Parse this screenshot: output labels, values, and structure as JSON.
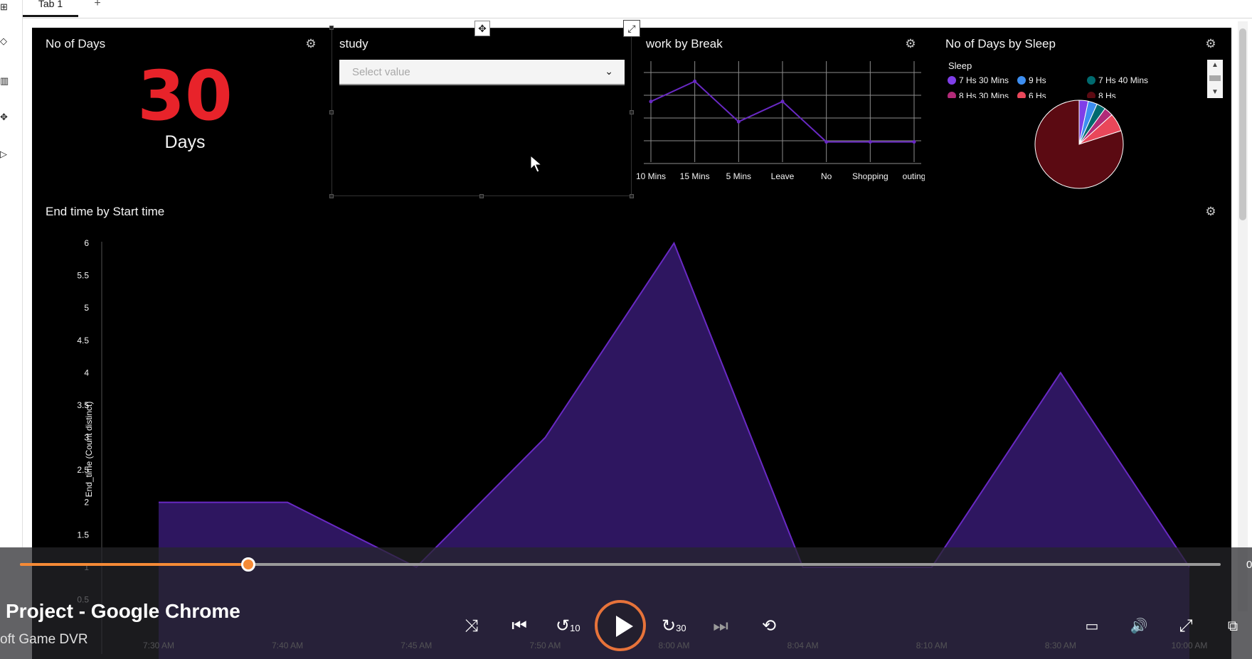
{
  "tabs": {
    "active_label": "Tab 1",
    "add_label": "+"
  },
  "kpi": {
    "title": "No of Days",
    "value": "30",
    "unit": "Days"
  },
  "study": {
    "title": "study",
    "select_placeholder": "Select value"
  },
  "line_widget": {
    "title": "work by Break"
  },
  "pie_widget": {
    "title": "No of Days by Sleep",
    "legend_title": "Sleep",
    "legend": [
      {
        "label": "7 Hs 30 Mins",
        "color": "#7f3ee8"
      },
      {
        "label": "9 Hs",
        "color": "#3d8ef0"
      },
      {
        "label": "7 Hs 40 Mins",
        "color": "#006a6e"
      },
      {
        "label": "8 Hs 30 Mins",
        "color": "#b22a78"
      },
      {
        "label": "6 Hs",
        "color": "#e9475a"
      },
      {
        "label": "8 Hs",
        "color": "#5b0a12"
      }
    ]
  },
  "area_widget": {
    "title": "End time by Start time",
    "ylabel": "End_time (Count distinct)"
  },
  "chart_data": [
    {
      "type": "line",
      "title": "work by Break",
      "categories": [
        "10 Mins",
        "15 Mins",
        "5 Mins",
        "Leave",
        "No",
        "Shopping",
        "outing"
      ],
      "values": [
        3,
        4,
        2,
        3,
        1,
        1,
        1
      ],
      "ylim": [
        0,
        5
      ],
      "grid": true,
      "color": "#6929c4"
    },
    {
      "type": "pie",
      "title": "No of Days by Sleep",
      "labels": [
        "7 Hs 30 Mins",
        "9 Hs",
        "7 Hs 40 Mins",
        "8 Hs 30 Mins",
        "6 Hs",
        "8 Hs"
      ],
      "values": [
        1,
        1,
        1,
        1,
        2,
        24
      ],
      "colors": [
        "#7f3ee8",
        "#3d8ef0",
        "#006a6e",
        "#b22a78",
        "#e9475a",
        "#5b0a12"
      ]
    },
    {
      "type": "area",
      "title": "End time by Start time",
      "ylabel": "End_time (Count distinct)",
      "x_ticks": [
        "7:30 AM",
        "7:40 AM",
        "7:45 AM",
        "7:50 AM",
        "8:00 AM",
        "8:04 AM",
        "8:10 AM",
        "8:30 AM",
        "10:00 AM"
      ],
      "values": [
        2,
        2,
        1,
        3,
        6,
        1,
        1,
        4,
        1
      ],
      "y_ticks": [
        "0.5",
        "1",
        "1.5",
        "2",
        "2.5",
        "3",
        "3.5",
        "4",
        "4.5",
        "5",
        "5.5",
        "6"
      ],
      "ylim": [
        0,
        6
      ],
      "color": "#6929c4"
    }
  ],
  "player": {
    "title": "Project - Google Chrome",
    "subtitle": "oft Game DVR",
    "time_right": "0",
    "progress_fraction": 0.19,
    "skip_back_label": "10",
    "skip_fwd_label": "30",
    "accent": "#f58a36"
  }
}
